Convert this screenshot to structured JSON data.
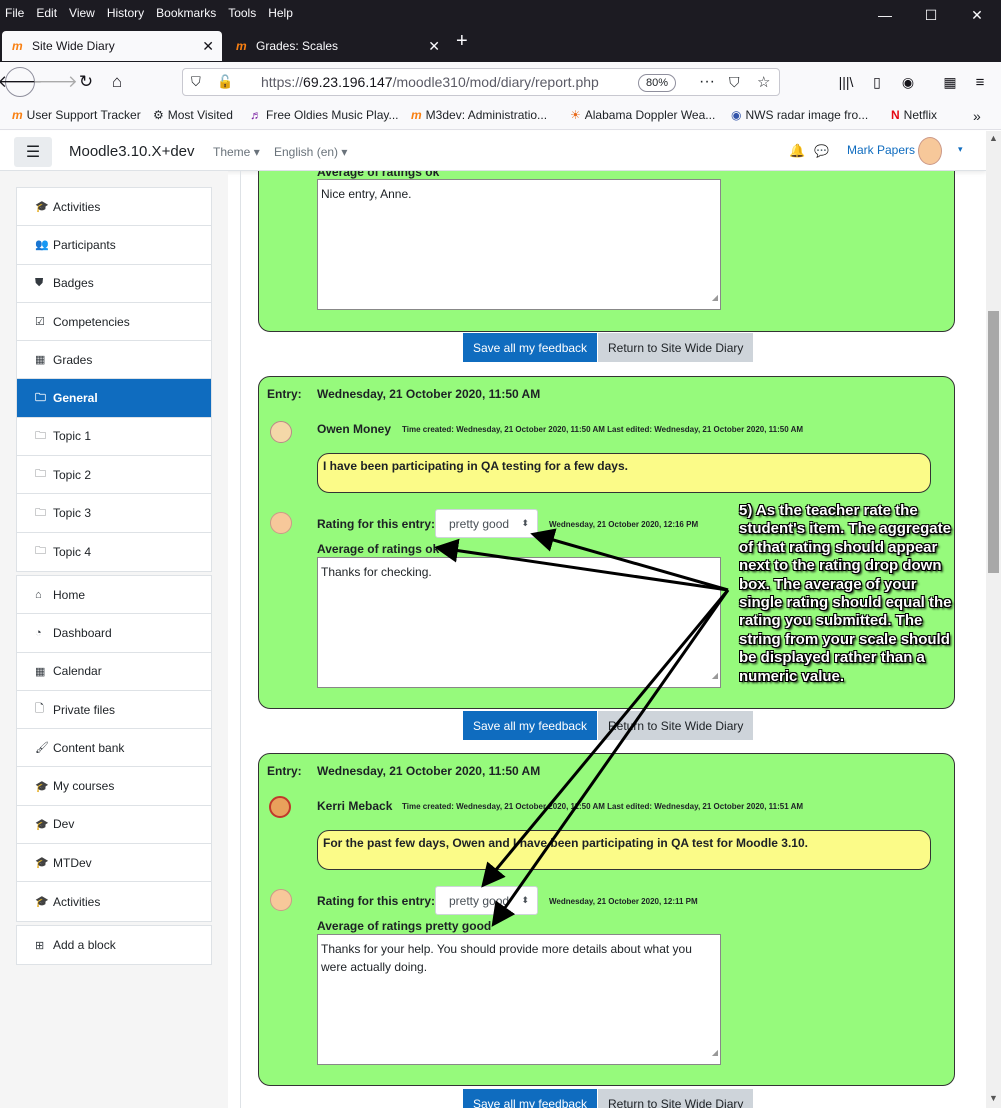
{
  "browser": {
    "menu": [
      "File",
      "Edit",
      "View",
      "History",
      "Bookmarks",
      "Tools",
      "Help"
    ],
    "tabs": [
      {
        "label": "Site Wide Diary",
        "active": true
      },
      {
        "label": "Grades: Scales",
        "active": false
      }
    ],
    "url_prefix": "https://",
    "url_host": "69.23.196.147",
    "url_path": "/moodle310/mod/diary/report.php",
    "zoom": "80%",
    "bookmarks": [
      "User Support Tracker",
      "Most Visited",
      "Free Oldies Music Play...",
      "M3dev: Administratio...",
      "Alabama Doppler Wea...",
      "NWS radar image fro...",
      "Netflix"
    ]
  },
  "moodle": {
    "site_name": "Moodle3.10.X+dev",
    "theme_label": "Theme",
    "language_label": "English (en)",
    "user_name": "Mark Papers",
    "nav_block1": [
      {
        "label": "Activities",
        "icon": "🎓"
      },
      {
        "label": "Participants",
        "icon": "👥"
      },
      {
        "label": "Badges",
        "icon": "⛊"
      },
      {
        "label": "Competencies",
        "icon": "☑"
      },
      {
        "label": "Grades",
        "icon": "▦"
      },
      {
        "label": "General",
        "icon": "🗀",
        "active": true
      },
      {
        "label": "Topic 1",
        "icon": "🗀"
      },
      {
        "label": "Topic 2",
        "icon": "🗀"
      },
      {
        "label": "Topic 3",
        "icon": "🗀"
      },
      {
        "label": "Topic 4",
        "icon": "🗀"
      }
    ],
    "nav_block2": [
      {
        "label": "Home",
        "icon": "⌂"
      },
      {
        "label": "Dashboard",
        "icon": "◔"
      },
      {
        "label": "Calendar",
        "icon": "▦"
      },
      {
        "label": "Private files",
        "icon": "🗋"
      },
      {
        "label": "Content bank",
        "icon": "🖌"
      },
      {
        "label": "My courses",
        "icon": "🎓"
      },
      {
        "label": "Dev",
        "icon": "🎓"
      },
      {
        "label": "MTDev",
        "icon": "🎓"
      },
      {
        "label": "Activities",
        "icon": "🎓"
      }
    ],
    "add_block": "Add a block"
  },
  "report": {
    "entry0": {
      "avg_label": "Average of ratings ok",
      "feedback": "Nice entry, Anne."
    },
    "entry1": {
      "entry_label": "Entry:",
      "date": "Wednesday, 21 October 2020, 11:50 AM",
      "student": "Owen Money",
      "meta": "Time created: Wednesday, 21 October 2020, 11:50 AM Last edited: Wednesday, 21 October 2020, 11:50 AM",
      "text": "I have been participating in QA testing for a few days.",
      "rating_label": "Rating for this entry:",
      "rating_value": "pretty good",
      "rating_time": "Wednesday, 21 October 2020, 12:16 PM",
      "avg_label": "Average of ratings ok",
      "feedback": "Thanks for checking."
    },
    "entry2": {
      "entry_label": "Entry:",
      "date": "Wednesday, 21 October 2020, 11:50 AM",
      "student": "Kerri Meback",
      "meta": "Time created: Wednesday, 21 October 2020, 11:50 AM Last edited: Wednesday, 21 October 2020, 11:51 AM",
      "text": "For the past few days, Owen and I have been participating in QA test for Moodle 3.10.",
      "rating_label": "Rating for this entry:",
      "rating_value": "pretty good",
      "rating_time": "Wednesday, 21 October 2020, 12:11 PM",
      "avg_label": "Average of ratings pretty good",
      "feedback": "Thanks for your help. You should provide more details about what you were actually doing."
    },
    "save_button": "Save all my feedback",
    "return_button": "Return to Site Wide Diary",
    "annotation": "5) As the teacher rate the student's item. The aggregate of that rating should appear next to the rating drop down box. The average of your single rating should equal the rating you submitted. The string from your scale should be displayed rather than a numeric value."
  },
  "colors": {
    "entry_bg": "#96fa7c",
    "entry_text_bg": "#fbfb88",
    "primary": "#0f6cbf"
  }
}
